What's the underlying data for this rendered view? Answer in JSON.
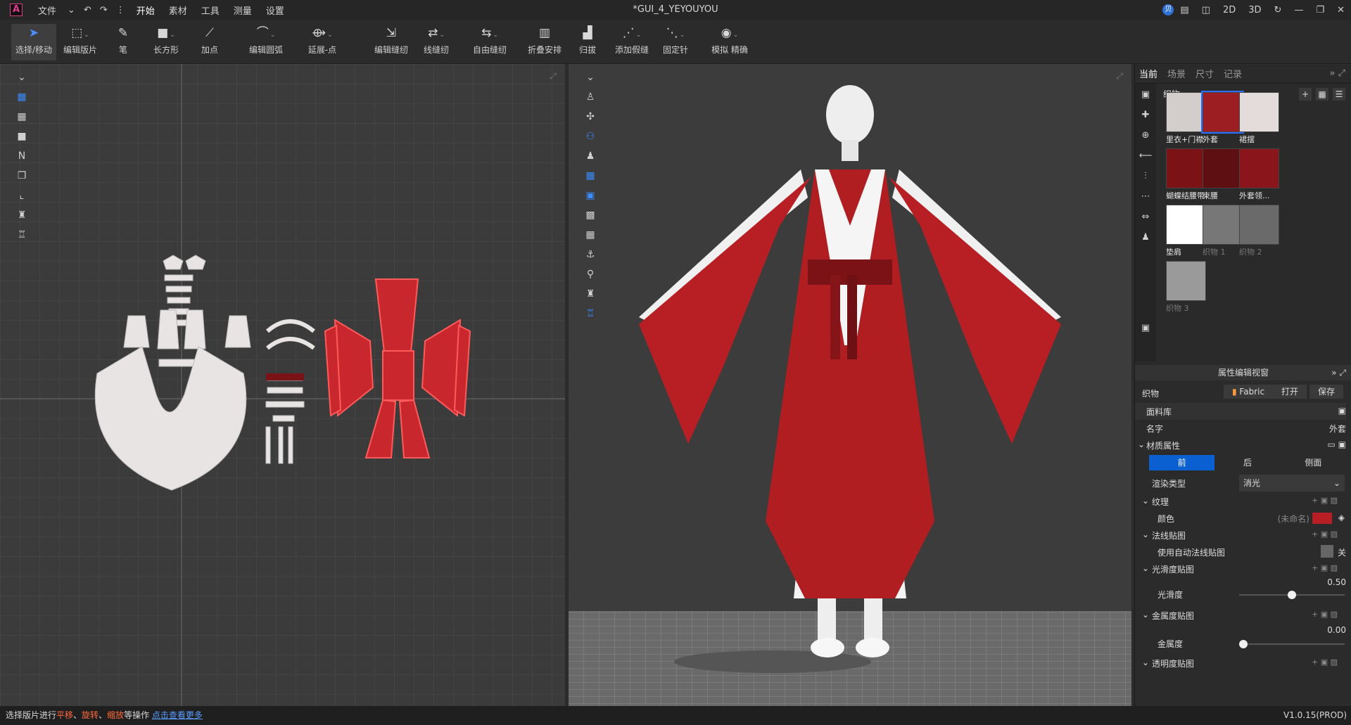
{
  "titlebar": {
    "menus": [
      "文件",
      "开始",
      "素材",
      "工具",
      "测量",
      "设置"
    ],
    "doc_title": "*GUI_4_YEYOUYOU",
    "avatar_letter": "贝",
    "mode_2d": "2D",
    "mode_3d": "3D"
  },
  "toolbar": {
    "tools": [
      "选择/移动",
      "编辑版片",
      "笔",
      "长方形",
      "加点",
      "编辑圆弧",
      "延展-点",
      "编辑缝纫",
      "线缝纫",
      "自由缝纫",
      "折叠安排",
      "归拔",
      "添加假缝",
      "固定针",
      "模拟 精确"
    ]
  },
  "right_panel": {
    "tabs": [
      "当前",
      "场景",
      "尺寸",
      "记录"
    ],
    "fabric_header": "织物",
    "fabrics": [
      {
        "name": "里衣+门襟",
        "color": "#d3cdcb"
      },
      {
        "name": "外套",
        "color": "#9c1e22"
      },
      {
        "name": "裙摆",
        "color": "#e3dcdb"
      },
      {
        "name": "蝴蝶结腰带",
        "color": "#7a1216"
      },
      {
        "name": "束腰",
        "color": "#5e0f12"
      },
      {
        "name": "外套领...",
        "color": "#8a161b"
      },
      {
        "name": "垫肩",
        "color": "#ffffff"
      },
      {
        "name": "织物 1",
        "color": "#777777"
      },
      {
        "name": "织物 2",
        "color": "#6a6a6a"
      },
      {
        "name": "织物 3",
        "color": "#9a9a9a"
      }
    ]
  },
  "props": {
    "header": "属性编辑视窗",
    "section": "织物",
    "fabric_btn": "Fabric",
    "open_btn": "打开",
    "save_btn": "保存",
    "library": "面料库",
    "name_label": "名字",
    "name_value": "外套",
    "material": "材质属性",
    "faces": [
      "前",
      "后",
      "侧面"
    ],
    "render_type_label": "渲染类型",
    "render_type_value": "消光",
    "texture": "纹理",
    "color_label": "颜色",
    "color_value": "(未命名)",
    "color_hex": "#b81f24",
    "normal_map": "法线贴图",
    "auto_normal": "使用自动法线贴图",
    "auto_normal_state": "关",
    "gloss_map": "光滑度贴图",
    "gloss_label": "光滑度",
    "gloss_value": "0.50",
    "metal_map": "金属度贴图",
    "metal_label": "金属度",
    "metal_value": "0.00",
    "transparency_map": "透明度贴图"
  },
  "status": {
    "prefix": "选择版片进行",
    "a": "平移",
    "sep1": "、",
    "b": "旋转",
    "sep2": "、",
    "c": "缩放",
    "suffix": "等操作 ",
    "link": "点击查看更多",
    "version": "V1.0.15(PROD)"
  }
}
